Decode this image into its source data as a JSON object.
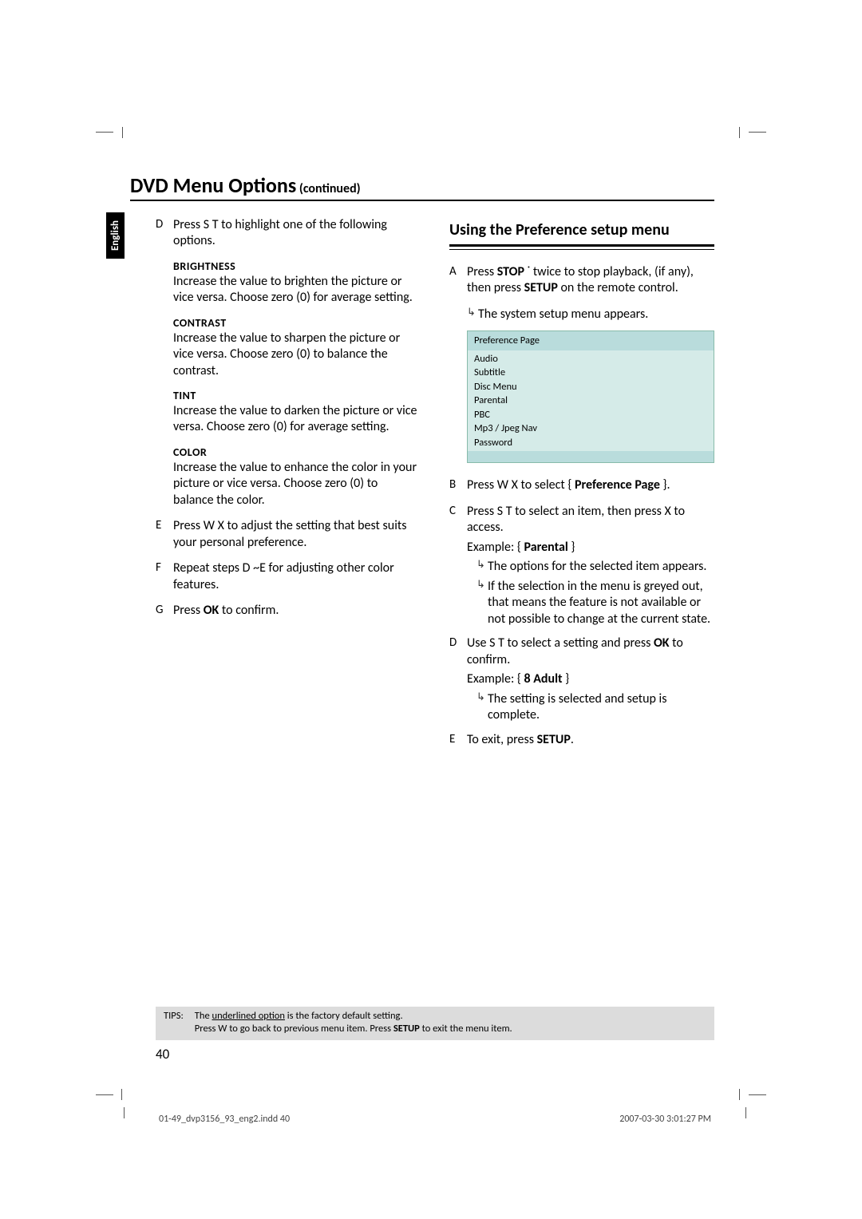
{
  "header": {
    "title": "DVD Menu Options",
    "continued": "(continued)"
  },
  "languageTab": "English",
  "left": {
    "stepD": "Press  S  T to highlight one of the following options.",
    "options": {
      "brightness": {
        "h": "BRIGHTNESS",
        "t": "Increase the value to brighten the picture or vice versa. Choose zero (0) for average setting."
      },
      "contrast": {
        "h": "CONTRAST",
        "t": "Increase the value to sharpen the picture or vice versa.  Choose zero (0) to balance the contrast."
      },
      "tint": {
        "h": "TINT",
        "t": "Increase the value to darken the picture or vice versa. Choose zero (0) for average setting."
      },
      "color": {
        "h": "COLOR",
        "t": "Increase the value to enhance the color in your picture or vice versa. Choose zero (0) to balance the color."
      }
    },
    "stepE": "Press  W X to adjust the setting that best suits your personal preference.",
    "stepF_a": "Repeat steps ",
    "stepF_b": "D",
    "stepF_c": " ~",
    "stepF_d": "E",
    "stepF_e": "  for adjusting other color features.",
    "stepG_a": "Press ",
    "stepG_b": "OK",
    "stepG_c": " to confirm."
  },
  "right": {
    "sectionTitle": "Using the Preference setup menu",
    "stepA_a": "Press ",
    "stepA_b": "STOP",
    "stepA_c": " ˙    twice to stop playback, (if any), then press ",
    "stepA_d": "SETUP",
    "stepA_e": " on the remote control.",
    "stepA_res": "The system setup menu appears.",
    "menu": {
      "title": "Preference Page",
      "items": [
        "Audio",
        "Subtitle",
        "Disc Menu",
        "Parental",
        "PBC",
        "Mp3 / Jpeg Nav",
        "Password"
      ]
    },
    "stepB_a": "Press  W X to select { ",
    "stepB_b": "Preference Page",
    "stepB_c": " }.",
    "stepC_a": "Press  S  T to select an item, then press  X to access.",
    "stepC_ex_a": "Example: { ",
    "stepC_ex_b": "Parental",
    "stepC_ex_c": " }",
    "stepC_r1": "The options for the selected item appears.",
    "stepC_r2": "If the selection in the menu is greyed out, that means the feature is not available or not possible to change at the current state.",
    "stepD_a": "Use  S  T to select a setting and press ",
    "stepD_b": "OK",
    "stepD_c": " to confirm.",
    "stepD_ex_a": "Example: { ",
    "stepD_ex_b": "8 Adult",
    "stepD_ex_c": " }",
    "stepD_r1": "The setting is selected and setup is complete.",
    "stepE_a": "To exit, press ",
    "stepE_b": "SETUP",
    "stepE_c": "."
  },
  "tips": {
    "label": "TIPS:",
    "l1_a": "The ",
    "l1_b": "underlined option",
    "l1_c": " is the factory default setting.",
    "l2_a": "Press W to go back to previous menu item. Press ",
    "l2_b": "SETUP",
    "l2_c": " to exit the menu item."
  },
  "pageNumber": "40",
  "imprint": {
    "left": "01-49_dvp3156_93_eng2.indd   40",
    "right": "2007-03-30   3:01:27 PM"
  }
}
